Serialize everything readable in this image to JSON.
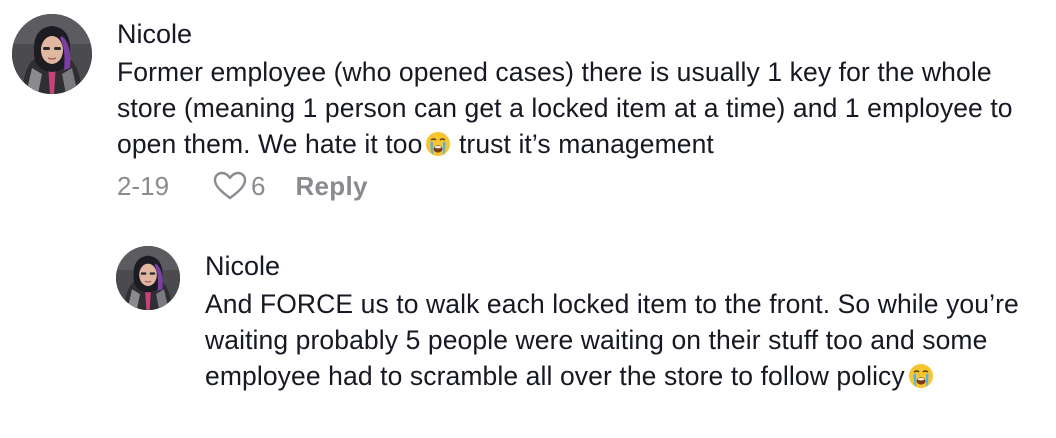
{
  "comments": [
    {
      "username": "Nicole",
      "text": "Former employee (who opened cases) there is usually 1 key for the whole store (meaning 1 person can get a locked item at a time) and 1 employee to open them. We hate it too",
      "text_after_emoji": " trust it’s management",
      "emoji": "loudly-crying-face-emoji",
      "date": "2-19",
      "likes": "6",
      "reply_label": "Reply"
    },
    {
      "username": "Nicole",
      "text": "And FORCE us to walk each locked item to the front. So while you’re waiting probably 5 people were waiting on their stuff too and some employee had to scramble all over the store to follow policy",
      "emoji": "loudly-crying-face-emoji"
    }
  ],
  "colors": {
    "text": "#161823",
    "meta": "#8a8b91",
    "background": "#ffffff"
  },
  "icons": [
    "heart-icon",
    "avatar",
    "loudly-crying-face-emoji"
  ]
}
